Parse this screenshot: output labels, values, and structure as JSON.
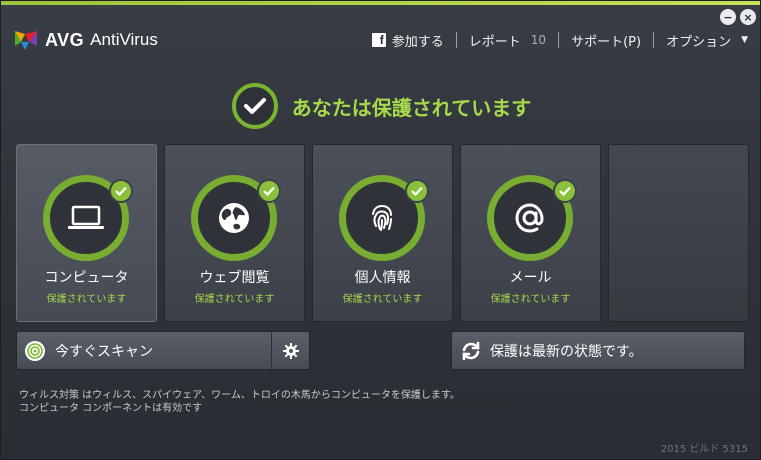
{
  "app": {
    "brand": "AVG",
    "product": "AntiVirus"
  },
  "window_controls": {
    "minimize": "−",
    "close": "×"
  },
  "nav": {
    "facebook_icon": "f",
    "join": "参加する",
    "report": "レポート",
    "report_count": "10",
    "support": "サポート(P)",
    "options": "オプション",
    "caret": "▼"
  },
  "status": {
    "text": "あなたは保護されています"
  },
  "tiles": [
    {
      "title": "コンピュータ",
      "status": "保護されています",
      "icon": "laptop-icon"
    },
    {
      "title": "ウェブ閲覧",
      "status": "保護されています",
      "icon": "globe-icon"
    },
    {
      "title": "個人情報",
      "status": "保護されています",
      "icon": "fingerprint-icon"
    },
    {
      "title": "メール",
      "status": "保護されています",
      "icon": "at-sign-icon"
    }
  ],
  "scan": {
    "label": "今すぐスキャン"
  },
  "update": {
    "label": "保護は最新の状態です。"
  },
  "info": {
    "line1": "ウィルス対策 はウィルス、スパイウェア、ワーム、トロイの木馬からコンピュータを保護します。",
    "line2": "コンピュータ コンポーネントは有効です"
  },
  "build": "2015 ビルド 5315",
  "colors": {
    "accent_green": "#7bb431",
    "status_green": "#a7d94a",
    "background": "#30333a"
  }
}
